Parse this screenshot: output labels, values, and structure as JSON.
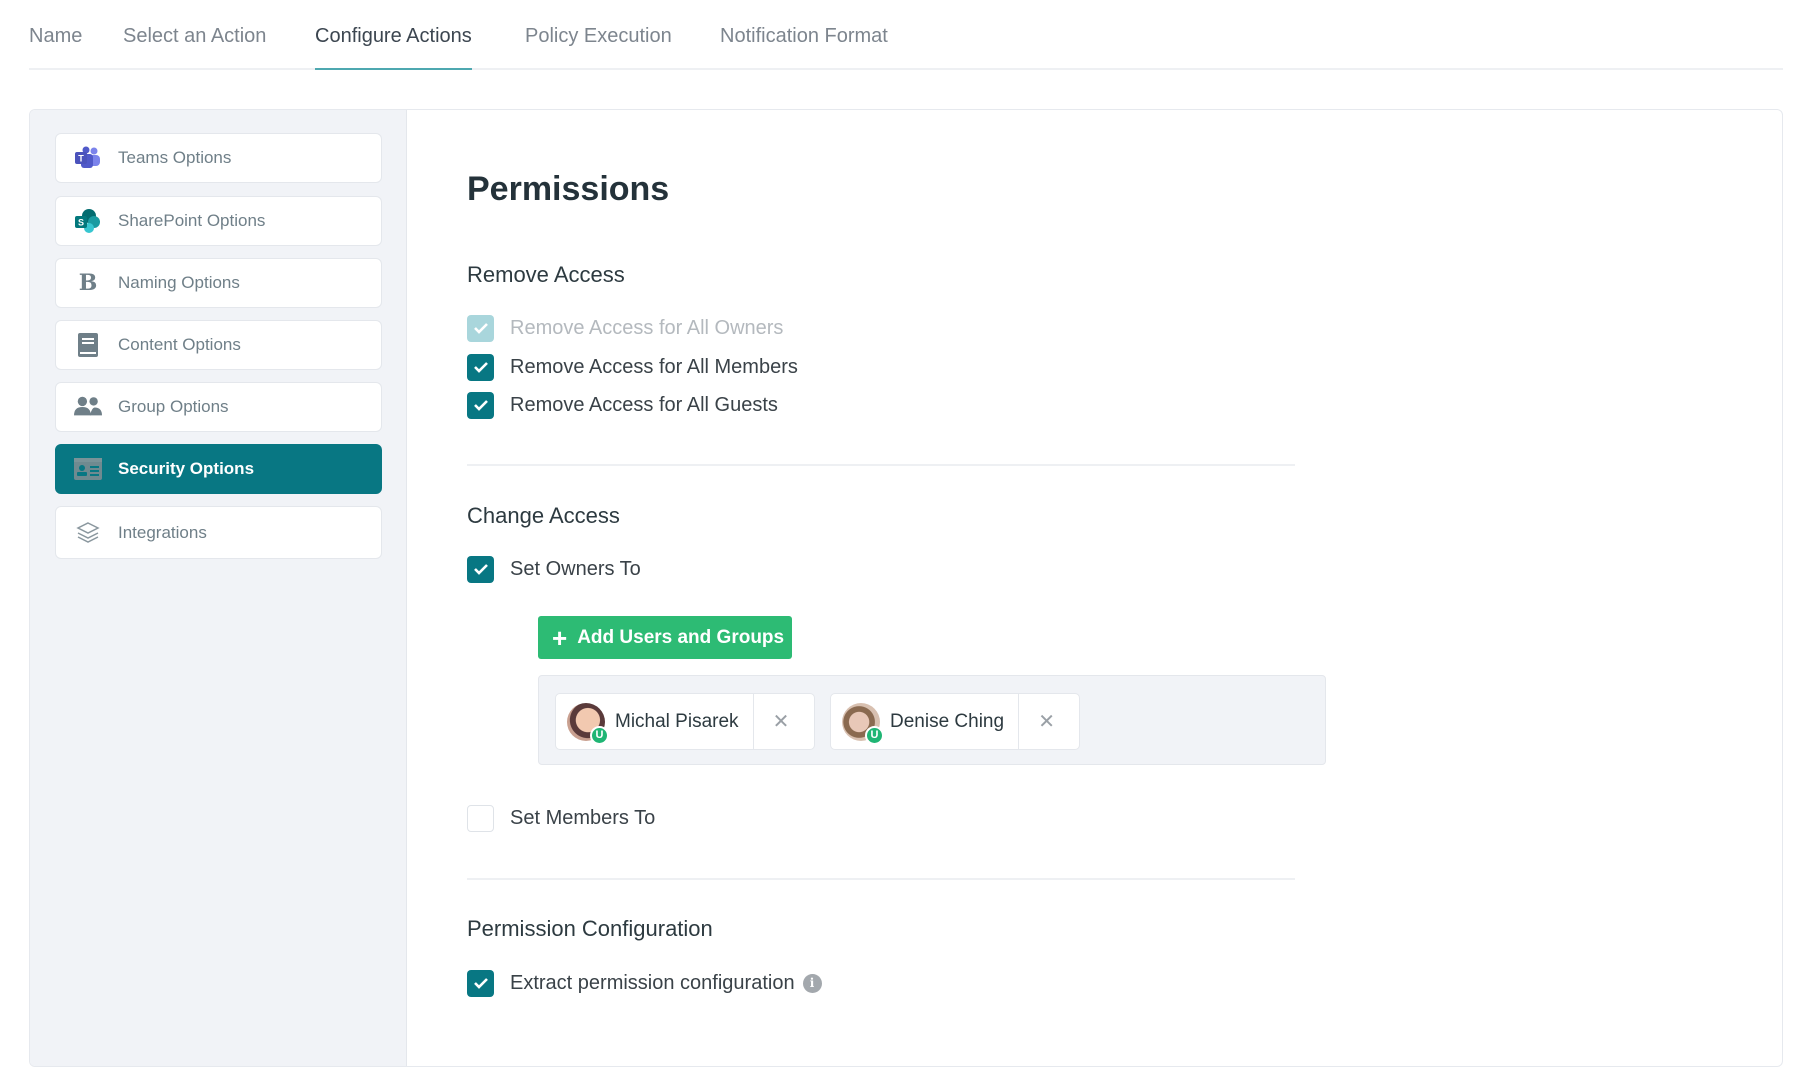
{
  "tabs": [
    {
      "label": "Name",
      "active": false
    },
    {
      "label": "Select an Action",
      "active": false
    },
    {
      "label": "Configure Actions",
      "active": true
    },
    {
      "label": "Policy Execution",
      "active": false
    },
    {
      "label": "Notification Format",
      "active": false
    }
  ],
  "sidebar": {
    "items": [
      {
        "label": "Teams Options",
        "icon": "teams-icon",
        "active": false
      },
      {
        "label": "SharePoint Options",
        "icon": "sharepoint-icon",
        "active": false
      },
      {
        "label": "Naming Options",
        "icon": "bold-b-icon",
        "active": false
      },
      {
        "label": "Content Options",
        "icon": "book-icon",
        "active": false
      },
      {
        "label": "Group Options",
        "icon": "users-icon",
        "active": false
      },
      {
        "label": "Security Options",
        "icon": "id-card-icon",
        "active": true
      },
      {
        "label": "Integrations",
        "icon": "layers-icon",
        "active": false
      }
    ]
  },
  "main": {
    "title": "Permissions",
    "remove_access": {
      "title": "Remove Access",
      "options": [
        {
          "label": "Remove Access for All Owners",
          "checked": true,
          "disabled": true
        },
        {
          "label": "Remove Access for All Members",
          "checked": true,
          "disabled": false
        },
        {
          "label": "Remove Access for All Guests",
          "checked": true,
          "disabled": false
        }
      ]
    },
    "change_access": {
      "title": "Change Access",
      "set_owners": {
        "label": "Set Owners To",
        "checked": true
      },
      "add_button": "Add Users and Groups",
      "users": [
        {
          "name": "Michal Pisarek",
          "badge": "U"
        },
        {
          "name": "Denise Ching",
          "badge": "U"
        }
      ],
      "set_members": {
        "label": "Set Members To",
        "checked": false
      }
    },
    "permission_configuration": {
      "title": "Permission Configuration",
      "extract": {
        "label": "Extract permission configuration",
        "checked": true,
        "info_icon": "i"
      }
    }
  },
  "colors": {
    "accent": "#087783",
    "accent_disabled": "#a9d6dc",
    "add_button": "#2dbb74",
    "tab_underline": "#4ea8b0"
  }
}
